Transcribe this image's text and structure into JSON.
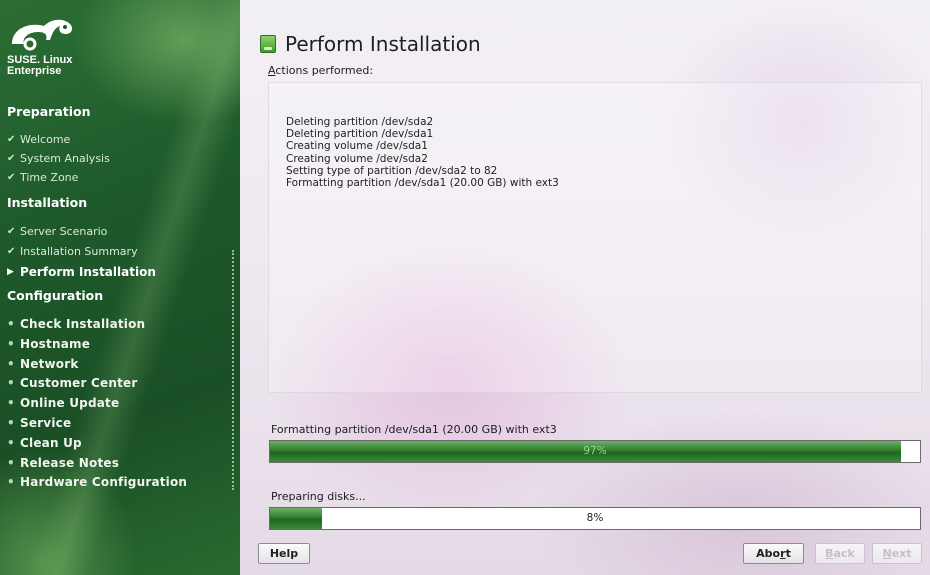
{
  "sidebar": {
    "brand_line1": "SUSE. Linux",
    "brand_line2": "Enterprise",
    "logo_icon": "chameleon-logo-icon",
    "sections": {
      "preparation": "Preparation",
      "installation": "Installation",
      "configuration": "Configuration"
    },
    "preparation_steps": [
      {
        "label": "Welcome",
        "state": "done"
      },
      {
        "label": "System Analysis",
        "state": "done"
      },
      {
        "label": "Time Zone",
        "state": "done"
      }
    ],
    "installation_steps": [
      {
        "label": "Server Scenario",
        "state": "done"
      },
      {
        "label": "Installation Summary",
        "state": "done"
      },
      {
        "label": "Perform Installation",
        "state": "current"
      }
    ],
    "configuration_steps": [
      {
        "label": "Check Installation",
        "state": "todo"
      },
      {
        "label": "Hostname",
        "state": "todo"
      },
      {
        "label": "Network",
        "state": "todo"
      },
      {
        "label": "Customer Center",
        "state": "todo"
      },
      {
        "label": "Online Update",
        "state": "todo"
      },
      {
        "label": "Service",
        "state": "todo"
      },
      {
        "label": "Clean Up",
        "state": "todo"
      },
      {
        "label": "Release Notes",
        "state": "todo"
      },
      {
        "label": "Hardware Configuration",
        "state": "todo"
      }
    ],
    "marks": {
      "done": "✔",
      "current": "▶",
      "todo": "•"
    }
  },
  "main": {
    "title": "Perform Installation",
    "title_icon": "install-package-icon",
    "actions_label_first": "A",
    "actions_label_rest": "ctions performed:",
    "log_lines": [
      "Deleting partition /dev/sda2",
      "Deleting partition /dev/sda1",
      "Creating volume /dev/sda1",
      "Creating volume /dev/sda2",
      "Setting type of partition /dev/sda2 to 82",
      "Formatting partition /dev/sda1 (20.00 GB) with ext3"
    ],
    "progress1": {
      "label": "Formatting partition /dev/sda1 (20.00 GB) with ext3",
      "text": "97%",
      "value": 0.97
    },
    "progress2": {
      "label": "Preparing disks...",
      "text": "8%",
      "value": 0.08
    }
  },
  "buttons": {
    "help": "Help",
    "abort_a": "Abo",
    "abort_u": "r",
    "abort_b": "t",
    "back_u": "B",
    "back_rest": "ack",
    "next_u": "N",
    "next_rest": "ext"
  },
  "colors": {
    "sidebar_green": "#1f5a2b",
    "progress_green": "#2f7d2f"
  }
}
